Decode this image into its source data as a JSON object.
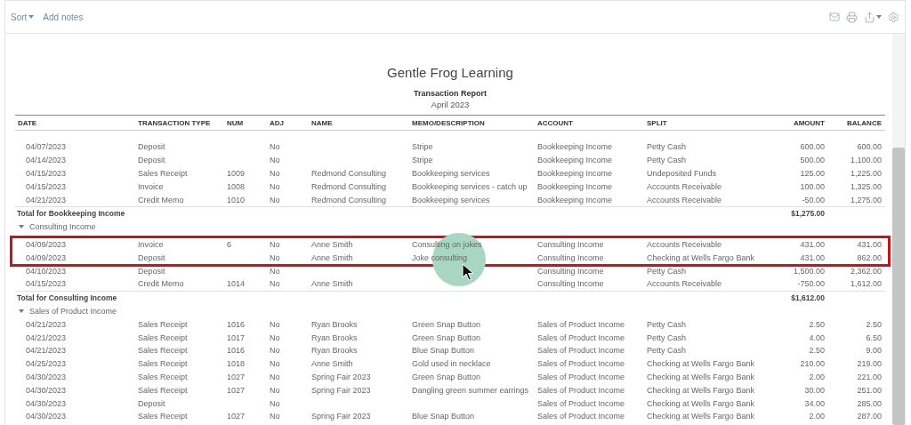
{
  "toolbar": {
    "sort": "Sort",
    "add_notes": "Add notes"
  },
  "report": {
    "company": "Gentle Frog Learning",
    "title": "Transaction Report",
    "period": "April 2023"
  },
  "columns": [
    "DATE",
    "TRANSACTION TYPE",
    "NUM",
    "ADJ",
    "NAME",
    "MEMO/DESCRIPTION",
    "ACCOUNT",
    "SPLIT",
    "AMOUNT",
    "BALANCE"
  ],
  "rows": [
    {
      "kind": "data",
      "highlighted": false,
      "cells": [
        "04/07/2023",
        "Deposit",
        "",
        "No",
        "",
        "Stripe",
        "Bookkeeping Income",
        "Petty Cash",
        "600.00",
        "600.00"
      ]
    },
    {
      "kind": "data",
      "highlighted": false,
      "cells": [
        "04/14/2023",
        "Deposit",
        "",
        "No",
        "",
        "Stripe",
        "Bookkeeping Income",
        "Petty Cash",
        "500.00",
        "1,100.00"
      ]
    },
    {
      "kind": "data",
      "highlighted": false,
      "cells": [
        "04/15/2023",
        "Sales Receipt",
        "1009",
        "No",
        "Redmond Consulting",
        "Bookkeeping services",
        "Bookkeeping Income",
        "Undeposited Funds",
        "125.00",
        "1,225.00"
      ]
    },
    {
      "kind": "data",
      "highlighted": false,
      "cells": [
        "04/15/2023",
        "Invoice",
        "1008",
        "No",
        "Redmond Consulting",
        "Bookkeeping services - catch up",
        "Bookkeeping Income",
        "Accounts Receivable",
        "100.00",
        "1,325.00"
      ]
    },
    {
      "kind": "data",
      "highlighted": false,
      "cells": [
        "04/21/2023",
        "Credit Memo",
        "1010",
        "No",
        "Redmond Consulting",
        "Bookkeeping services",
        "Bookkeeping Income",
        "Accounts Receivable",
        "-50.00",
        "1,275.00"
      ]
    },
    {
      "kind": "total",
      "label": "Total for Bookkeeping Income",
      "amount": "$1,275.00"
    },
    {
      "kind": "group",
      "label": "Consulting Income",
      "expanded": true
    },
    {
      "kind": "data",
      "highlighted": true,
      "cells": [
        "04/09/2023",
        "Invoice",
        "6",
        "No",
        "Anne Smith",
        "Consulting on jokes",
        "Consulting Income",
        "Accounts Receivable",
        "431.00",
        "431.00"
      ]
    },
    {
      "kind": "data",
      "highlighted": true,
      "cells": [
        "04/09/2023",
        "Deposit",
        "",
        "No",
        "Anne Smith",
        "Joke consulting",
        "Consulting Income",
        "Checking at Wells Fargo Bank",
        "431.00",
        "862.00"
      ]
    },
    {
      "kind": "data",
      "highlighted": false,
      "cells": [
        "04/10/2023",
        "Deposit",
        "",
        "No",
        "",
        "",
        "Consulting Income",
        "Petty Cash",
        "1,500.00",
        "2,362.00"
      ]
    },
    {
      "kind": "data",
      "highlighted": false,
      "cells": [
        "04/15/2023",
        "Credit Memo",
        "1014",
        "No",
        "Anne Smith",
        "",
        "Consulting Income",
        "Accounts Receivable",
        "-750.00",
        "1,612.00"
      ]
    },
    {
      "kind": "total",
      "label": "Total for Consulting Income",
      "amount": "$1,612.00"
    },
    {
      "kind": "group",
      "label": "Sales of Product Income",
      "expanded": true
    },
    {
      "kind": "data",
      "highlighted": false,
      "cells": [
        "04/21/2023",
        "Sales Receipt",
        "1016",
        "No",
        "Ryan Brooks",
        "Green Snap Button",
        "Sales of Product Income",
        "Petty Cash",
        "2.50",
        "2.50"
      ]
    },
    {
      "kind": "data",
      "highlighted": false,
      "cells": [
        "04/21/2023",
        "Sales Receipt",
        "1017",
        "No",
        "Ryan Brooks",
        "Green Snap Button",
        "Sales of Product Income",
        "Petty Cash",
        "4.00",
        "6.50"
      ]
    },
    {
      "kind": "data",
      "highlighted": false,
      "cells": [
        "04/21/2023",
        "Sales Receipt",
        "1016",
        "No",
        "Ryan Brooks",
        "Blue Snap Button",
        "Sales of Product Income",
        "Petty Cash",
        "2.50",
        "9.00"
      ]
    },
    {
      "kind": "data",
      "highlighted": false,
      "cells": [
        "04/25/2023",
        "Sales Receipt",
        "1018",
        "No",
        "Anne Smith",
        "Gold used in necklace",
        "Sales of Product Income",
        "Checking at Wells Fargo Bank",
        "210.00",
        "219.00"
      ]
    },
    {
      "kind": "data",
      "highlighted": false,
      "cells": [
        "04/30/2023",
        "Sales Receipt",
        "1027",
        "No",
        "Spring Fair 2023",
        "Green Snap Button",
        "Sales of Product Income",
        "Checking at Wells Fargo Bank",
        "2.00",
        "221.00"
      ]
    },
    {
      "kind": "data",
      "highlighted": false,
      "cells": [
        "04/30/2023",
        "Sales Receipt",
        "1027",
        "No",
        "Spring Fair 2023",
        "Dangling green summer earrings",
        "Sales of Product Income",
        "Checking at Wells Fargo Bank",
        "30.00",
        "251.00"
      ]
    },
    {
      "kind": "data",
      "highlighted": false,
      "cells": [
        "04/30/2023",
        "Deposit",
        "",
        "No",
        "",
        "",
        "Sales of Product Income",
        "Checking at Wells Fargo Bank",
        "34.00",
        "285.00"
      ]
    },
    {
      "kind": "data",
      "highlighted": false,
      "cells": [
        "04/30/2023",
        "Sales Receipt",
        "1027",
        "No",
        "Spring Fair 2023",
        "Blue Snap Button",
        "Sales of Product Income",
        "Checking at Wells Fargo Bank",
        "2.00",
        "287.00"
      ]
    }
  ]
}
